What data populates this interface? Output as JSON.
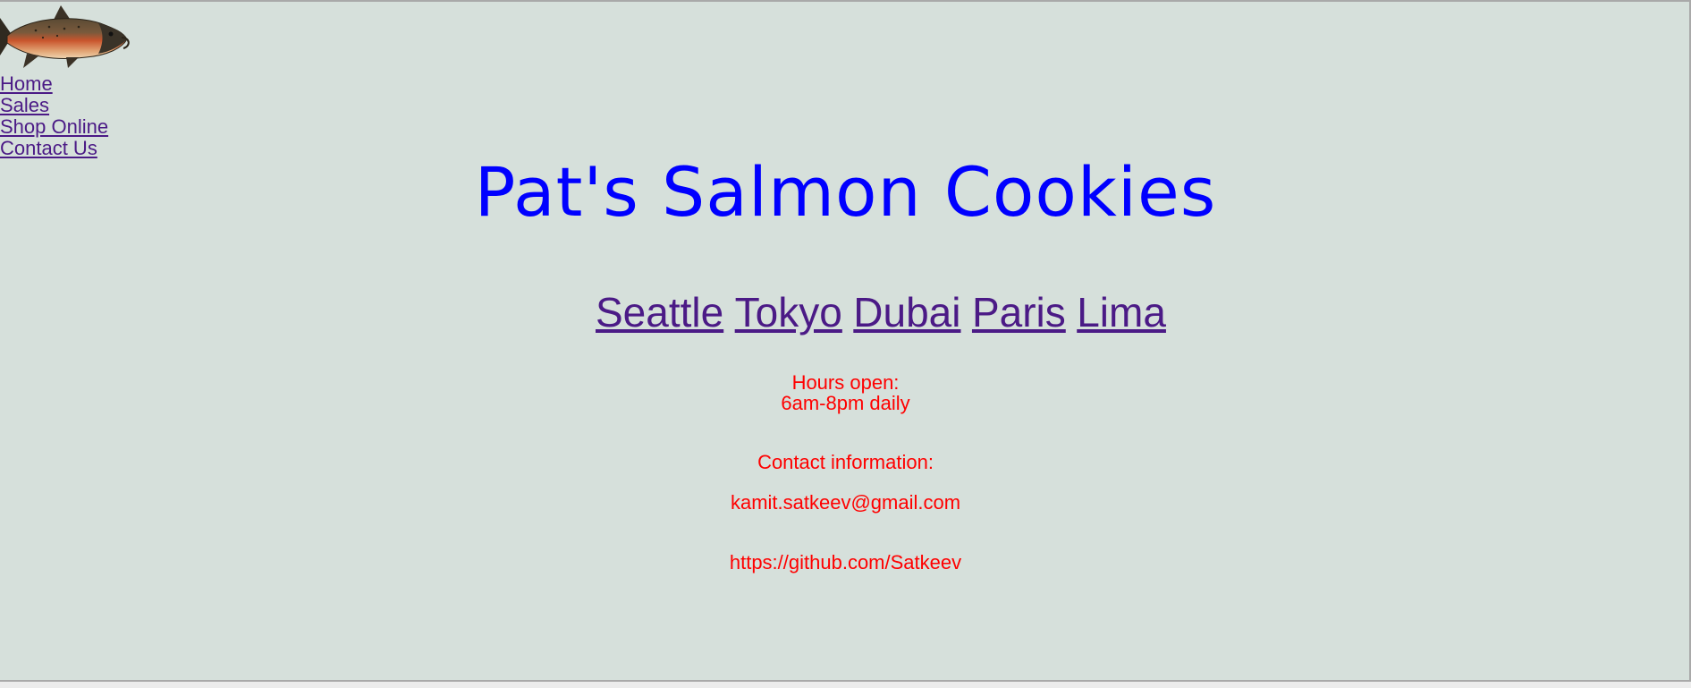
{
  "nav": {
    "items": [
      "Home",
      "Sales",
      "Shop Online",
      "Contact Us"
    ]
  },
  "header": {
    "title": "Pat's Salmon Cookies"
  },
  "cities": [
    "Seattle",
    "Tokyo",
    "Dubai",
    "Paris",
    "Lima"
  ],
  "info": {
    "hours_label": "Hours open:",
    "hours_value": "6am-8pm daily",
    "contact_label": "Contact information:",
    "email": "kamit.satkeev@gmail.com",
    "github": "https://github.com/Satkeev"
  },
  "colors": {
    "background": "#d6e0db",
    "title": "#0000ff",
    "link": "#4b1a86",
    "info_text": "#ff0000"
  },
  "icons": {
    "logo": "salmon-fish-icon"
  }
}
